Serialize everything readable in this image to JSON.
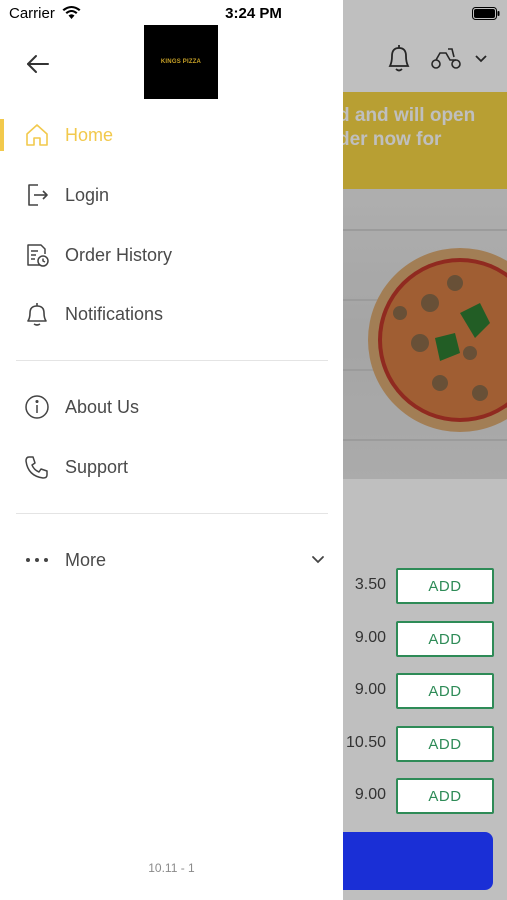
{
  "status_bar": {
    "carrier": "Carrier",
    "time": "3:24 PM"
  },
  "drawer": {
    "logo_text": "KINGS PIZZA",
    "items": [
      {
        "label": "Home",
        "icon": "home-icon",
        "active": true
      },
      {
        "label": "Login",
        "icon": "login-icon"
      },
      {
        "label": "Order History",
        "icon": "order-history-icon"
      },
      {
        "label": "Notifications",
        "icon": "bell-icon"
      },
      {
        "label": "About Us",
        "icon": "info-icon"
      },
      {
        "label": "Support",
        "icon": "phone-icon"
      },
      {
        "label": "More",
        "icon": "more-dots-icon"
      }
    ],
    "version": "10.11 - 1",
    "accent_color": "#f2c94c"
  },
  "background": {
    "banner_line1": "d and will open",
    "banner_line2": "der now for",
    "banner_color": "#f6d545",
    "menu_rows": [
      {
        "price": "3.50",
        "button": "ADD"
      },
      {
        "price": "9.00",
        "button": "ADD"
      },
      {
        "price": "9.00",
        "button": "ADD"
      },
      {
        "price": "10.50",
        "button": "ADD"
      },
      {
        "price": "9.00",
        "button": "ADD"
      }
    ],
    "add_button_color": "#2e8b57",
    "bottom_button_color": "#1a2fd6"
  }
}
